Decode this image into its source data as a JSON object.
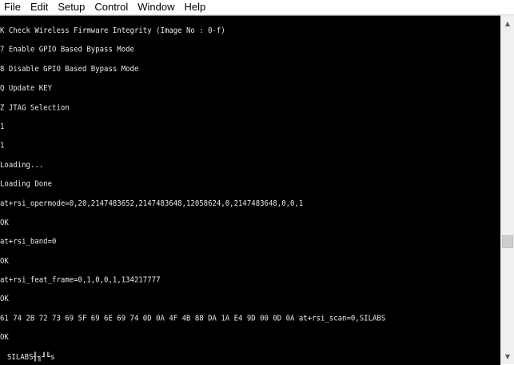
{
  "menu": [
    "File",
    "Edit",
    "Setup",
    "Control",
    "Window",
    "Help"
  ],
  "terminal": {
    "lines": [
      "K Check Wireless Firmware Integrity (Image No : 0-f)",
      "7 Enable GPIO Based Bypass Mode",
      "8 Disable GPIO Based Bypass Mode",
      "Q Update KEY",
      "Z JTAG Selection",
      "1",
      "1",
      "Loading...",
      "Loading Done",
      "at+rsi_opermode=0,20,2147483652,2147483648,12058624,0,2147483648,0,0,1",
      "OK",
      "at+rsi_band=0",
      "OK",
      "at+rsi_feat_frame=0,1,0,0,1,134217777",
      "OK",
      "61 74 2B 72 73 69 5F 69 6E 69 74 0D 0A 4F 4B 88 DA 1A E4 9D 00 0D 0A at+rsi_scan=0,SILABS",
      "OK"
    ],
    "cursor_line": "SILABS╢╖╜╙s"
  },
  "scrollbar": {
    "up_arrow": "▲",
    "down_arrow": "▼",
    "position_fraction": 0.67
  }
}
